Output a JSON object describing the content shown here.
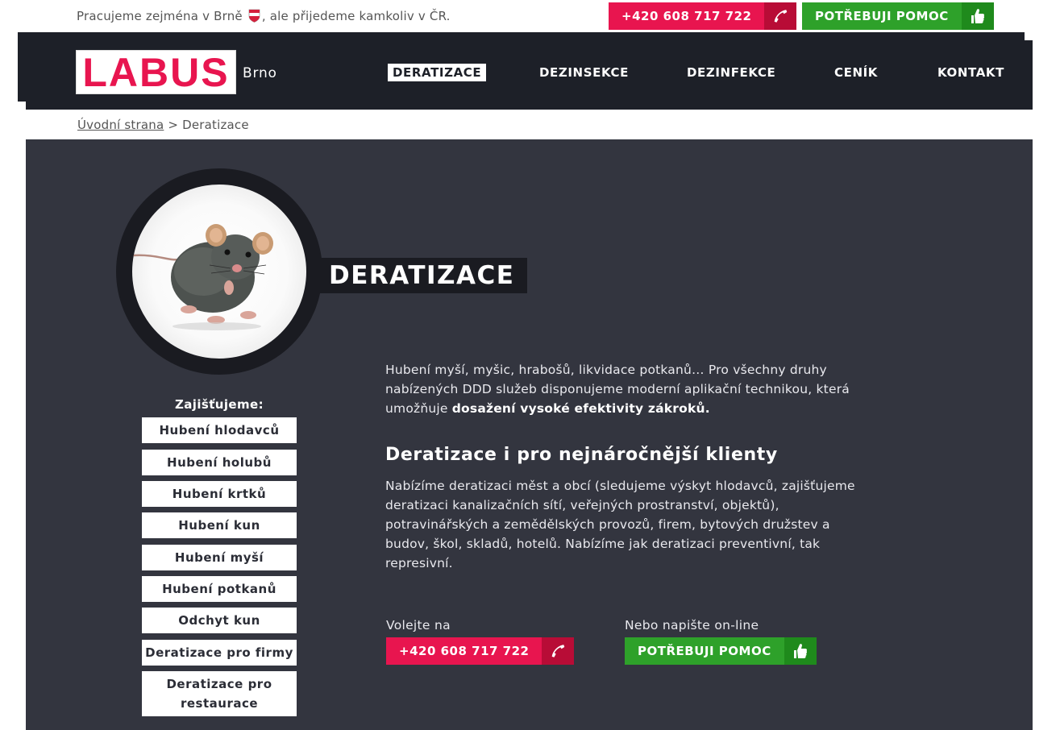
{
  "topbar": {
    "tagline_before": "Pracujeme zejména v Brně",
    "tagline_after": ", ale přijedeme kamkoliv v ČR.",
    "phone_label": "+420 608 717 722",
    "help_label": "POTŘEBUJI POMOC"
  },
  "header": {
    "logo_text": "LABUS",
    "city": "Brno",
    "nav": [
      {
        "label": "DERATIZACE",
        "active": true
      },
      {
        "label": "DEZINSEKCE"
      },
      {
        "label": "DEZINFEKCE"
      },
      {
        "label": "CENÍK"
      },
      {
        "label": "KONTAKT"
      }
    ]
  },
  "breadcrumb": {
    "home": "Úvodní strana",
    "separator": ">",
    "current": "Deratizace"
  },
  "main": {
    "title": "DERATIZACE",
    "sidebar": {
      "heading": "Zajišťujeme:",
      "items": [
        "Hubení hlodavců",
        "Hubení holubů",
        "Hubení krtků",
        "Hubení kun",
        "Hubení myší",
        "Hubení potkanů",
        "Odchyt kun",
        "Deratizace pro firmy",
        "Deratizace pro restaurace"
      ]
    },
    "intro_text": "Hubení myší, myšic, hrabošů, likvidace potkanů… Pro všechny druhy nabízených DDD služeb disponujeme moderní aplikační technikou, která umožňuje ",
    "intro_bold": "dosažení vysoké efektivity zákroků.",
    "section_heading": "Deratizace i pro nejnáročnější klienty",
    "section_text": "Nabízíme deratizaci měst a obcí (sledujeme výskyt hlodavců, zajišťujeme deratizaci kanalizačních sítí, veřejných prostranství, objektů), potravinářských a zemědělských provozů, firem, bytových družstev a budov, škol, skladů, hotelů. Nabízíme jak deratizaci preventivní, tak represivní.",
    "cta_phone_label": "Volejte na",
    "cta_phone": "+420 608 717 722",
    "cta_help_label": "Nebo napište on-line",
    "cta_help": "POTŘEBUJI POMOC"
  },
  "colors": {
    "accent_red": "#e8154f",
    "accent_green": "#2ea12a",
    "header_bg": "#1d2028",
    "main_bg": "#33353f"
  }
}
